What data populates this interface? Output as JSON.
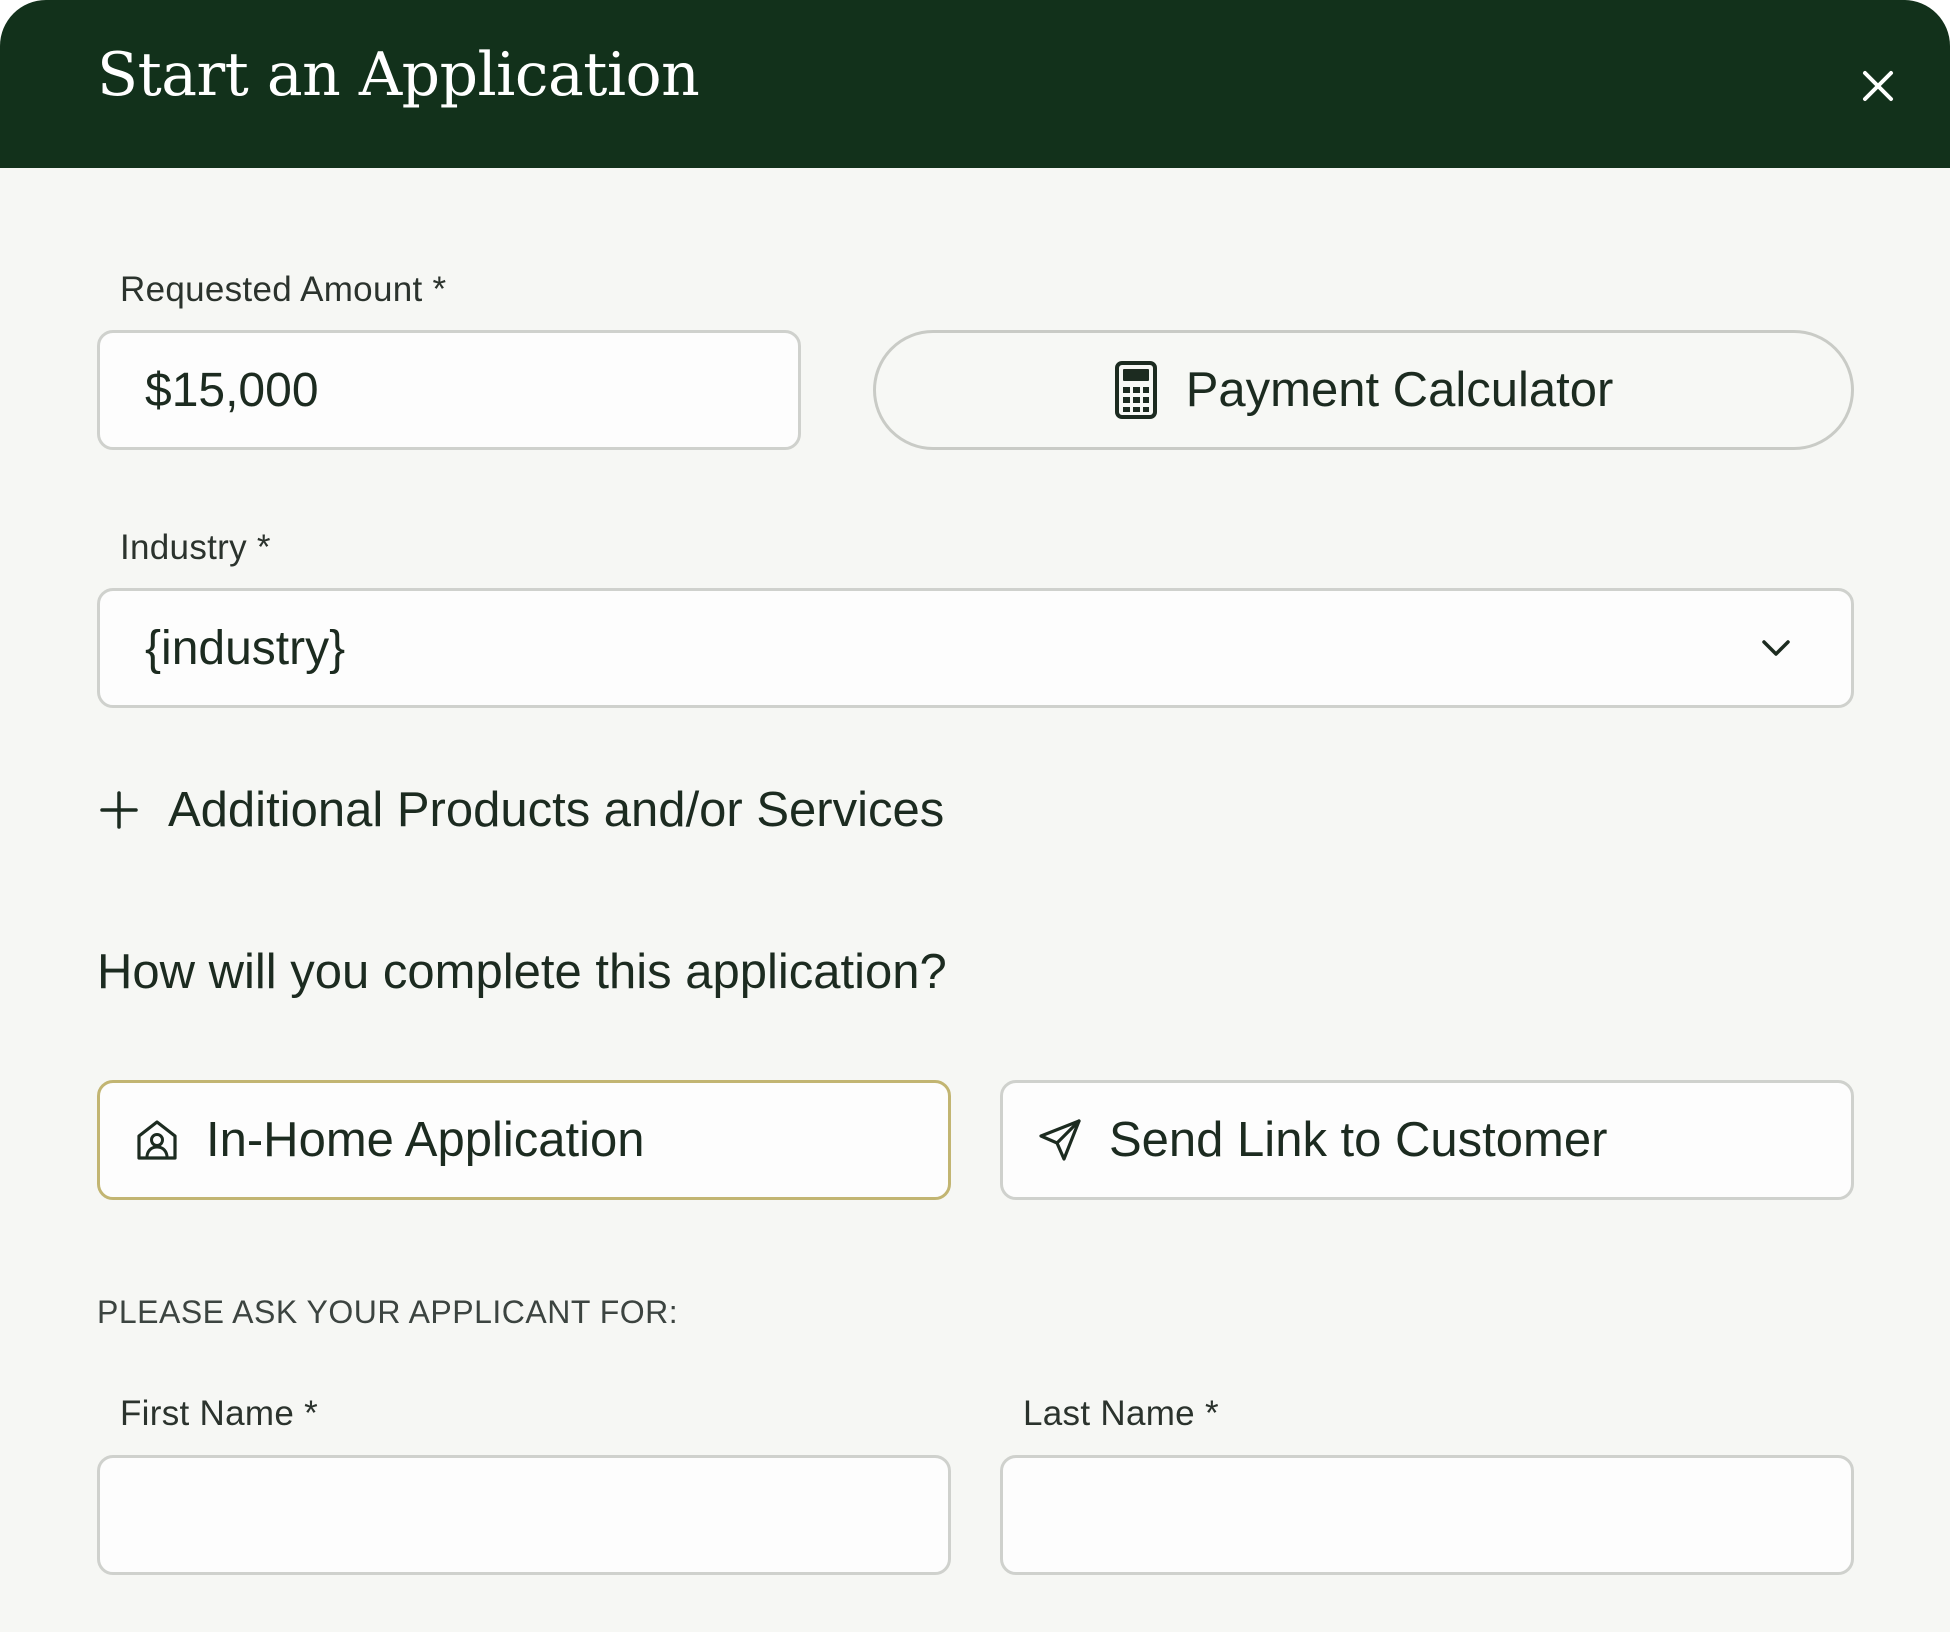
{
  "header": {
    "title": "Start an Application",
    "close_icon": "close-icon"
  },
  "requested_amount": {
    "label": "Requested Amount *",
    "value": "$15,000"
  },
  "payment_calculator": {
    "label": "Payment Calculator",
    "icon": "calculator-icon"
  },
  "industry": {
    "label": "Industry *",
    "value": "{industry}",
    "icon": "chevron-down-icon"
  },
  "additional": {
    "label": "Additional Products and/or Services",
    "icon": "plus-icon"
  },
  "completion": {
    "question": "How will you complete this application?",
    "options": [
      {
        "label": "In-Home Application",
        "icon": "home-user-icon",
        "selected": true
      },
      {
        "label": "Send Link to Customer",
        "icon": "send-icon",
        "selected": false
      }
    ]
  },
  "applicant": {
    "section_label": "PLEASE ASK YOUR APPLICANT FOR:",
    "first_name": {
      "label": "First Name *",
      "value": ""
    },
    "last_name": {
      "label": "Last Name *",
      "value": ""
    }
  },
  "colors": {
    "header_bg": "#12311b",
    "page_bg": "#f6f7f4",
    "selected_border": "#c2b572",
    "input_border": "#cfd1cd",
    "text": "#1c2b20"
  }
}
